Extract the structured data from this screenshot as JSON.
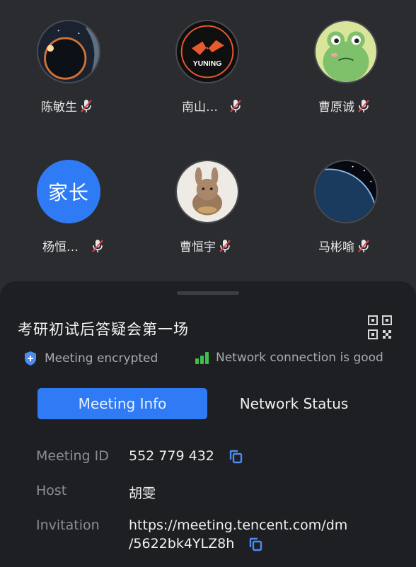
{
  "participants": [
    {
      "name": "陈敏生",
      "avatar": "eclipse-planet",
      "muted": true
    },
    {
      "name": "南山…",
      "avatar": "yuning-logo",
      "logo_text": "YUNING",
      "muted": true
    },
    {
      "name": "曹原诚",
      "avatar": "frog-cartoon",
      "muted": true
    },
    {
      "name": "杨恒…",
      "avatar": "text-avatar",
      "avatar_text": "家长",
      "avatar_color": "#2f7bf5",
      "muted": true
    },
    {
      "name": "曹恒宇",
      "avatar": "bunny-cartoon",
      "muted": true
    },
    {
      "name": "马彬喻",
      "avatar": "earth-space",
      "muted": true
    }
  ],
  "meeting": {
    "title": "考研初试后答疑会第一场",
    "encrypted_label": "Meeting encrypted",
    "network_label": "Network connection is good"
  },
  "tabs": {
    "active": "Meeting Info",
    "inactive": "Network Status"
  },
  "info": {
    "id_label": "Meeting ID",
    "id_value": "552 779 432",
    "host_label": "Host",
    "host_value": "胡雯",
    "invitation_label": "Invitation",
    "invitation_line1": "https://meeting.tencent.com/dm",
    "invitation_line2": "/5622bk4YLZ8h"
  },
  "colors": {
    "accent": "#2f7bf5",
    "mute_red": "#e0474c",
    "signal_green": "#3fbf4f",
    "background": "#2b2c30",
    "sheet": "#1e1f22"
  }
}
